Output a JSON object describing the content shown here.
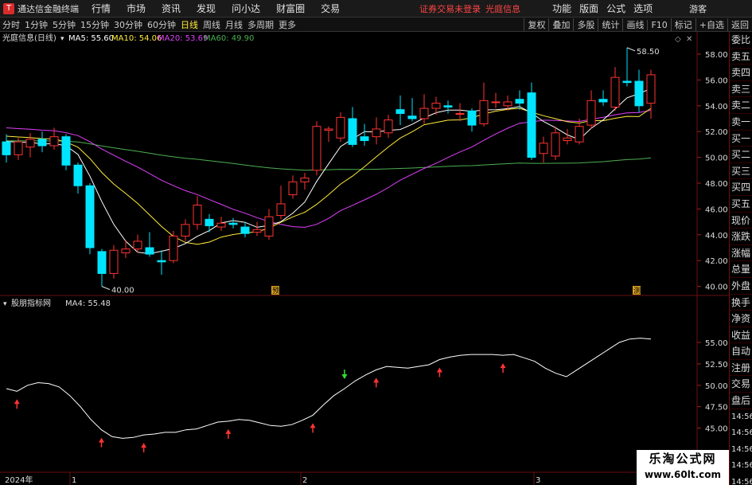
{
  "app": {
    "logo_char": "T",
    "name": "通达信金融终端",
    "menu": [
      "行情",
      "市场",
      "资讯",
      "发现",
      "问小达",
      "财富圈",
      "交易"
    ],
    "login_status": "证券交易未登录",
    "stock_name": "光庭信息",
    "right_menu": [
      "功能",
      "版面",
      "公式",
      "选项"
    ],
    "guest": "游客"
  },
  "toolbar": {
    "periods": [
      "分时",
      "1分钟",
      "5分钟",
      "15分钟",
      "30分钟",
      "60分钟",
      "日线",
      "周线",
      "月线",
      "多周期",
      "更多"
    ],
    "active_period": "日线",
    "right_buttons": [
      "复权",
      "叠加",
      "多股",
      "统计",
      "画线",
      "F10",
      "标记",
      "+自选",
      "返回"
    ]
  },
  "main_panel": {
    "title": "光庭信息(日线)",
    "ma_labels": [
      {
        "text": "MA5: 55.60",
        "color": "#ffffff"
      },
      {
        "text": "MA10: 54.06",
        "color": "#ffeb3b"
      },
      {
        "text": "MA20: 53.69",
        "color": "#e040fb"
      },
      {
        "text": "MA60: 49.90",
        "color": "#4caf50"
      }
    ],
    "y_ticks": [
      "58.00",
      "56.00",
      "54.00",
      "52.00",
      "50.00",
      "48.00",
      "46.00",
      "44.00",
      "42.00",
      "40.00"
    ],
    "y_tick_values": [
      58,
      56,
      54,
      52,
      50,
      48,
      46,
      44,
      42,
      40
    ],
    "high_label": "58.50",
    "low_label": "40.00",
    "marker_1": "预",
    "marker_2": "测"
  },
  "sub_panel": {
    "title": "股朋指标网",
    "ma4_label": "MA4: 55.48",
    "y_ticks": [
      "55.00",
      "52.50",
      "50.00",
      "47.50",
      "45.00"
    ],
    "y_tick_values": [
      55,
      52.5,
      50,
      47.5,
      45
    ]
  },
  "x_axis": {
    "labels": [
      "2024年",
      "1",
      "2",
      "3"
    ]
  },
  "side_panel": {
    "items": [
      "委比",
      "卖五",
      "卖四",
      "卖三",
      "卖二",
      "卖一",
      "买一",
      "买二",
      "买三",
      "买四",
      "买五",
      "现价",
      "涨跌",
      "涨幅",
      "总量",
      "外盘",
      "换手",
      "净资",
      "收益",
      "自动",
      "注册",
      "交易",
      "盘后"
    ],
    "times": [
      "14:56",
      "14:56",
      "14:56",
      "14:56",
      "14:56",
      "14:56",
      "14:56"
    ]
  },
  "colors": {
    "up": "#ff3333",
    "down": "#00e5ff",
    "ma5": "#ffffff",
    "ma10": "#ffeb3b",
    "ma20": "#e040fb",
    "ma60": "#4caf50",
    "grid": "#6a1010"
  },
  "candles": [
    [
      51.2,
      50.2,
      51.8,
      49.6
    ],
    [
      50.2,
      51.2,
      51.5,
      49.8
    ],
    [
      50.8,
      51.4,
      51.9,
      50.0
    ],
    [
      51.4,
      50.9,
      52.0,
      50.4
    ],
    [
      50.9,
      51.6,
      52.3,
      50.6
    ],
    [
      51.6,
      49.4,
      51.8,
      49.0
    ],
    [
      49.4,
      47.8,
      49.6,
      47.2
    ],
    [
      47.8,
      43.0,
      48.0,
      42.5
    ],
    [
      42.7,
      41.0,
      42.9,
      40.0
    ],
    [
      41.0,
      42.8,
      43.2,
      40.6
    ],
    [
      42.6,
      42.9,
      43.6,
      42.2
    ],
    [
      42.9,
      43.5,
      44.0,
      42.6
    ],
    [
      43.0,
      42.5,
      44.2,
      42.3
    ],
    [
      42.0,
      41.9,
      42.8,
      40.9
    ],
    [
      42.0,
      43.9,
      44.3,
      41.8
    ],
    [
      43.9,
      44.8,
      45.2,
      43.5
    ],
    [
      44.8,
      46.3,
      47.0,
      44.4
    ],
    [
      45.2,
      44.7,
      45.6,
      44.2
    ],
    [
      44.6,
      44.9,
      45.4,
      44.3
    ],
    [
      44.9,
      44.8,
      45.3,
      44.5
    ],
    [
      44.6,
      44.1,
      45.0,
      43.8
    ],
    [
      44.2,
      44.4,
      45.0,
      43.9
    ],
    [
      43.9,
      45.4,
      46.0,
      43.6
    ],
    [
      45.5,
      46.4,
      47.8,
      45.2
    ],
    [
      47.1,
      48.1,
      48.6,
      46.8
    ],
    [
      48.1,
      48.4,
      48.8,
      47.5
    ],
    [
      49.0,
      52.4,
      52.8,
      48.6
    ],
    [
      52.1,
      52.2,
      52.4,
      51.2
    ],
    [
      51.5,
      53.1,
      53.5,
      51.2
    ],
    [
      53.0,
      51.0,
      53.9,
      50.8
    ],
    [
      51.6,
      51.3,
      52.6,
      50.9
    ],
    [
      51.6,
      52.2,
      53.1,
      51.0
    ],
    [
      51.9,
      52.9,
      53.3,
      51.5
    ],
    [
      53.7,
      53.4,
      54.8,
      52.5
    ],
    [
      53.2,
      53.0,
      54.6,
      52.8
    ],
    [
      53.0,
      53.8,
      54.9,
      52.6
    ],
    [
      53.8,
      54.2,
      54.7,
      53.3
    ],
    [
      54.0,
      53.9,
      54.4,
      53.4
    ],
    [
      53.4,
      53.4,
      54.2,
      52.8
    ],
    [
      53.6,
      52.5,
      53.8,
      52.0
    ],
    [
      52.6,
      54.4,
      55.8,
      52.4
    ],
    [
      54.3,
      54.3,
      55.0,
      53.8
    ],
    [
      54.0,
      54.3,
      54.8,
      53.6
    ],
    [
      54.5,
      54.2,
      55.2,
      53.7
    ],
    [
      55.0,
      50.0,
      55.8,
      49.8
    ],
    [
      50.3,
      51.1,
      51.6,
      49.6
    ],
    [
      50.1,
      51.9,
      52.4,
      49.8
    ],
    [
      51.3,
      51.5,
      52.2,
      51.0
    ],
    [
      51.2,
      52.4,
      53.0,
      51.0
    ],
    [
      52.5,
      54.4,
      55.2,
      52.2
    ],
    [
      54.5,
      54.3,
      55.2,
      54.0
    ],
    [
      53.9,
      56.2,
      57.0,
      53.6
    ],
    [
      55.9,
      55.8,
      58.5,
      55.5
    ],
    [
      55.9,
      54.0,
      56.8,
      53.5
    ],
    [
      54.2,
      56.4,
      56.8,
      53.0
    ]
  ],
  "indicator": [
    49.6,
    49.3,
    50.0,
    50.3,
    50.2,
    49.8,
    48.8,
    47.5,
    46.0,
    44.8,
    44.0,
    43.8,
    43.9,
    44.2,
    44.3,
    44.5,
    44.5,
    44.8,
    44.9,
    45.3,
    45.7,
    45.8,
    46.0,
    45.9,
    45.6,
    45.3,
    45.2,
    45.4,
    45.9,
    46.5,
    47.7,
    48.8,
    49.6,
    50.5,
    51.2,
    51.8,
    52.2,
    52.1,
    52.0,
    52.2,
    52.4,
    53.0,
    53.3,
    53.5,
    53.6,
    53.6,
    53.6,
    53.5,
    53.6,
    53.2,
    52.8,
    52.0,
    51.4,
    51.0,
    51.8,
    52.6,
    53.4,
    54.2,
    55.0,
    55.4,
    55.5,
    55.4
  ],
  "buy_signals": [
    1,
    9,
    13,
    21,
    29,
    35,
    41,
    47
  ],
  "sell_signals": [
    32
  ]
}
